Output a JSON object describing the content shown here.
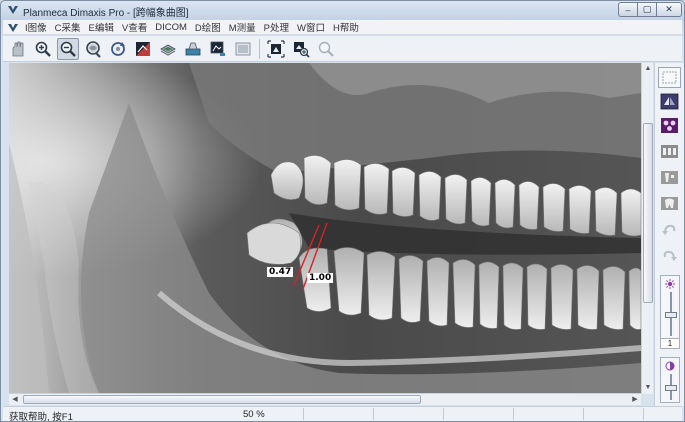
{
  "window": {
    "title": "Planmeca Dimaxis Pro - [跨幅象曲图]",
    "controls": {
      "minimize": "–",
      "maximize": "▢",
      "close": "✕"
    }
  },
  "menubar": {
    "items": [
      "I图像",
      "C采集",
      "E编辑",
      "V查看",
      "DICOM",
      "D绘图",
      "M测量",
      "P处理",
      "W窗口",
      "H帮助"
    ]
  },
  "toolbar": {
    "buttons": [
      {
        "icon": "hand-pan-icon"
      },
      {
        "icon": "zoom-in-icon"
      },
      {
        "icon": "zoom-out-icon",
        "active": true
      },
      {
        "icon": "magnifier-lens-icon"
      },
      {
        "icon": "rotate-icon"
      },
      {
        "icon": "contrast-icon"
      },
      {
        "icon": "stack-layers-icon"
      },
      {
        "icon": "scanner-icon"
      },
      {
        "icon": "image-export-icon"
      },
      {
        "icon": "image-frame-icon"
      },
      {
        "icon": "fit-window-icon"
      },
      {
        "icon": "zoom-region-icon"
      },
      {
        "icon": "zoom-disabled-icon"
      }
    ]
  },
  "image": {
    "measurements": [
      {
        "label": "0.47"
      },
      {
        "label": "1.00"
      }
    ]
  },
  "side_panel": {
    "tools": [
      "select-rect-icon",
      "flip-tool-icon",
      "color-map-icon",
      "tooth-numbering-icon",
      "implant-icon",
      "tooth-outline-icon",
      "undo-arc-icon",
      "redo-arc-icon"
    ],
    "brightness_value": "1",
    "brightness_level": 0.5,
    "contrast_level": 0.5
  },
  "status": {
    "help_text": "获取帮助, 按F1",
    "zoom": "50 %"
  },
  "colors": {
    "chrome": "#dce6f2",
    "measure_line": "#d8202a",
    "active_tool_bg": "#5b1b6b"
  }
}
